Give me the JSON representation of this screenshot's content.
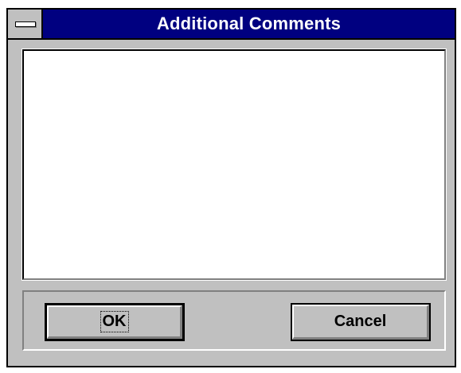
{
  "dialog": {
    "title": "Additional Comments"
  },
  "comments": {
    "value": ""
  },
  "buttons": {
    "ok_label": "OK",
    "cancel_label": "Cancel"
  },
  "icons": {
    "system_menu": "system-menu-icon"
  },
  "colors": {
    "title_bar": "#000080",
    "title_text": "#ffffff",
    "window_face": "#c0c0c0",
    "text_area": "#ffffff"
  }
}
